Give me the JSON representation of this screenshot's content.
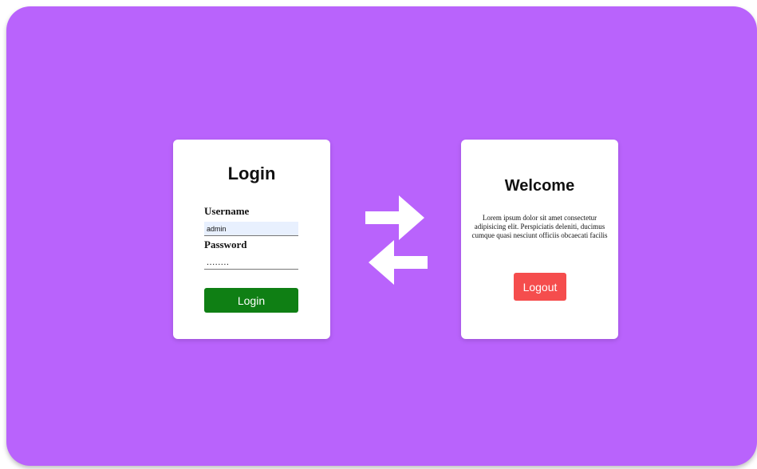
{
  "login_card": {
    "title": "Login",
    "username_label": "Username",
    "username_value": "admin",
    "password_label": "Password",
    "password_value": "........",
    "button_label": "Login"
  },
  "welcome_card": {
    "title": "Welcome",
    "body_text": "Lorem ipsum dolor sit amet consectetur adipisicing elit. Perspiciatis deleniti, ducimus cumque quasi nesciunt officiis obcaecati facilis",
    "button_label": "Logout"
  },
  "icons": {
    "arrows": "swap-arrows-icon"
  },
  "colors": {
    "background": "#b963fc",
    "login_button": "#0f7f14",
    "logout_button": "#f54d4d",
    "username_field": "#e8f0fe"
  }
}
